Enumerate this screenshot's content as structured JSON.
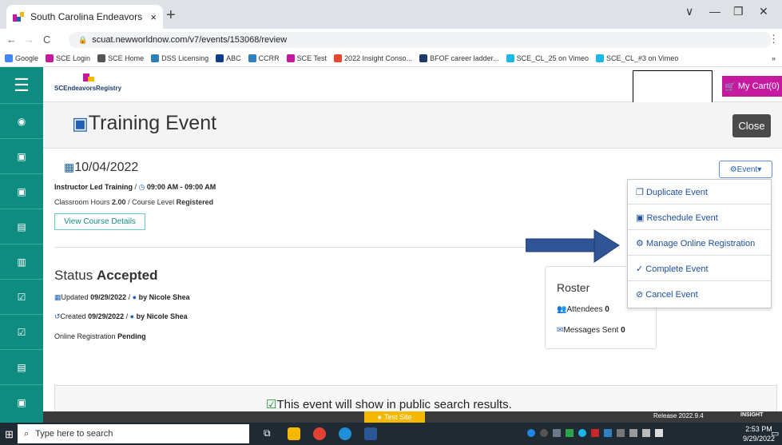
{
  "browser": {
    "tab_title": "South Carolina Endeavors Regist",
    "tab_close": "×",
    "new_tab": "+",
    "url": "scuat.newworldnow.com/v7/events/153068/review",
    "window_controls": [
      "∨",
      "—",
      "❐",
      "✕"
    ],
    "bookmarks": [
      {
        "label": "Google",
        "color": "#4285f4"
      },
      {
        "label": "SCE Login",
        "color": "#c5199f"
      },
      {
        "label": "SCE Home",
        "color": "#555555"
      },
      {
        "label": "DSS Licensing",
        "color": "#2c7fb8"
      },
      {
        "label": "ABC",
        "color": "#0c3c8a"
      },
      {
        "label": "CCRR",
        "color": "#2f80c0"
      },
      {
        "label": "SCE Test",
        "color": "#c5199f"
      },
      {
        "label": "2022 Insight Conso...",
        "color": "#e8452c"
      },
      {
        "label": "BFOF career ladder...",
        "color": "#1e3a6b"
      },
      {
        "label": "SCE_CL_25 on Vimeo",
        "color": "#1ab7ea"
      },
      {
        "label": "SCE_CL_#3 on Vimeo",
        "color": "#1ab7ea"
      }
    ],
    "bookmarks_more": "»"
  },
  "app": {
    "logo_text": "SCEndeavorsRegistry",
    "cart_label": "My Cart(0)",
    "page_title": "Training Event",
    "close_label": "Close"
  },
  "event": {
    "date": "10/04/2022",
    "type": "Instructor Led Training",
    "time": "09:00 AM - 09:00 AM",
    "hours_label": "Classroom Hours",
    "hours_value": "2.00",
    "level_label": "Course Level",
    "level_value": "Registered",
    "view_details": "View Course Details",
    "status_label": "Status",
    "status_value": "Accepted",
    "updated_label": "Updated",
    "updated_date": "09/29/2022",
    "updated_by": "by Nicole Shea",
    "created_label": "Created",
    "created_date": "09/29/2022",
    "created_by": "by Nicole Shea",
    "online_reg_label": "Online Registration",
    "online_reg_value": "Pending"
  },
  "roster": {
    "title": "Roster",
    "attendees_label": "Attendees",
    "attendees_value": "0",
    "messages_label": "Messages Sent",
    "messages_value": "0"
  },
  "event_menu": {
    "button_label": "Event",
    "items": [
      "Duplicate Event",
      "Reschedule Event",
      "Manage Online Registration",
      "Complete Event",
      "Cancel Event"
    ]
  },
  "public_notice": "This event will show in public search results.",
  "footer": {
    "test_site": "Test Site",
    "release": "Release 2022.9.4",
    "insight": "INSIGHT"
  },
  "taskbar": {
    "search_placeholder": "Type here to search",
    "time": "2:53 PM",
    "date": "9/29/2022"
  },
  "colors": {
    "sidebar": "#0e8c7f",
    "cart": "#c5199f",
    "link": "#1f4fa0",
    "arrow": "#2f5597"
  }
}
